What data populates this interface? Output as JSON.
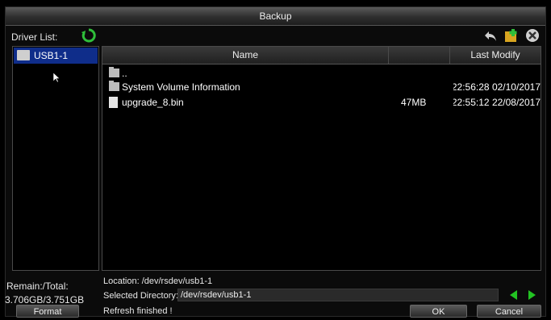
{
  "window": {
    "title": "Backup"
  },
  "drivers": {
    "label": "Driver List:",
    "items": [
      {
        "label": "USB1-1"
      }
    ]
  },
  "table": {
    "columns": [
      "Name",
      "",
      "Last Modify"
    ],
    "rows": [
      {
        "type": "folder",
        "name": "..",
        "size": "",
        "modified": ""
      },
      {
        "type": "folder",
        "name": "System Volume Information",
        "size": "",
        "modified": "02/10/2017 22:56:28"
      },
      {
        "type": "file",
        "name": "upgrade_8.bin",
        "size": "47MB",
        "modified": "22/08/2017 22:55:12"
      }
    ]
  },
  "storage": {
    "label": "Remain:/Total:",
    "value": "3.706GB/3.751GB"
  },
  "location": "Location: /dev/rsdev/usb1-1",
  "selected": {
    "label": "Selected Directory:",
    "value": "/dev/rsdev/usb1-1"
  },
  "status": "Refresh finished !",
  "buttons": {
    "format": "Format",
    "ok": "OK",
    "cancel": "Cancel"
  },
  "icons": {
    "refresh": "refresh-icon",
    "back": "back-icon",
    "new_folder": "new-folder-icon",
    "delete": "delete-icon",
    "prev": "arrow-left-icon",
    "next": "arrow-right-icon"
  },
  "colors": {
    "selection": "#0f2d8a",
    "arrows": "#22c322",
    "refresh": "#2fbf3a"
  }
}
